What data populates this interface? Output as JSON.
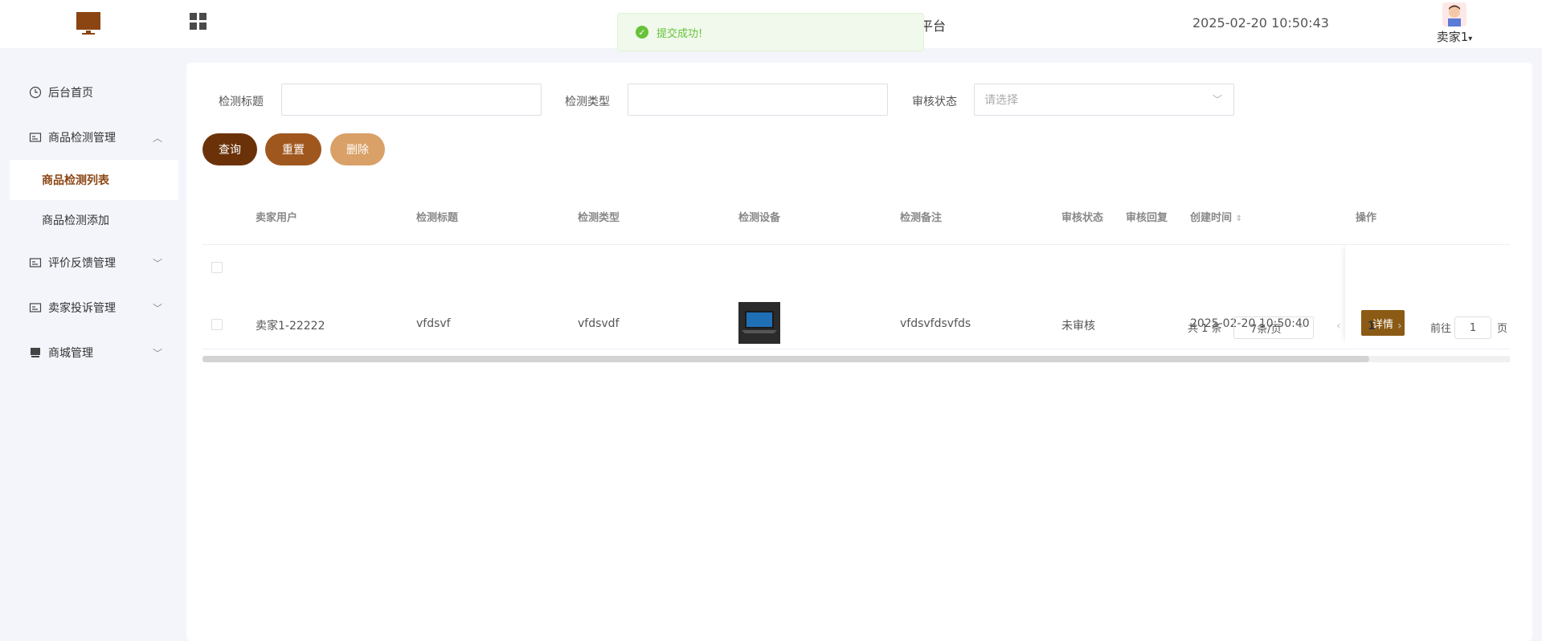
{
  "header": {
    "site_title_suffix": "平台",
    "datetime": "2025-02-20 10:50:43",
    "user_name": "卖家1",
    "colors": {
      "accent": "#8b4513"
    }
  },
  "toast": {
    "message": "提交成功!",
    "color": "#67c23a"
  },
  "sidebar": {
    "items": [
      {
        "label": "后台首页",
        "icon": "clock-icon"
      },
      {
        "label": "商品检测管理",
        "icon": "card-icon",
        "expanded": true,
        "children": [
          {
            "label": "商品检测列表",
            "active": true
          },
          {
            "label": "商品检测添加"
          }
        ]
      },
      {
        "label": "评价反馈管理",
        "icon": "card-icon"
      },
      {
        "label": "卖家投诉管理",
        "icon": "card-icon"
      },
      {
        "label": "商城管理",
        "icon": "shop-icon"
      }
    ]
  },
  "filters": {
    "title_label": "检测标题",
    "type_label": "检测类型",
    "status_label": "审核状态",
    "status_placeholder": "请选择"
  },
  "buttons": {
    "query": "查询",
    "reset": "重置",
    "delete": "删除"
  },
  "table": {
    "headers": [
      "卖家用户",
      "检测标题",
      "检测类型",
      "检测设备",
      "检测备注",
      "审核状态",
      "审核回复",
      "创建时间",
      "操作"
    ],
    "rows": [
      {
        "seller": "卖家1-22222",
        "title": "vfdsvf",
        "type": "vfdsvdf",
        "remark": "vfdsvfdsvfds",
        "status": "未审核",
        "reply": "",
        "created": "2025-02-20 10:50:40",
        "action": "详情"
      }
    ]
  },
  "pagination": {
    "total": "共 1 条",
    "page_size": "7条/页",
    "current": "1",
    "goto_label": "前往",
    "goto_value": "1",
    "page_label": "页"
  }
}
